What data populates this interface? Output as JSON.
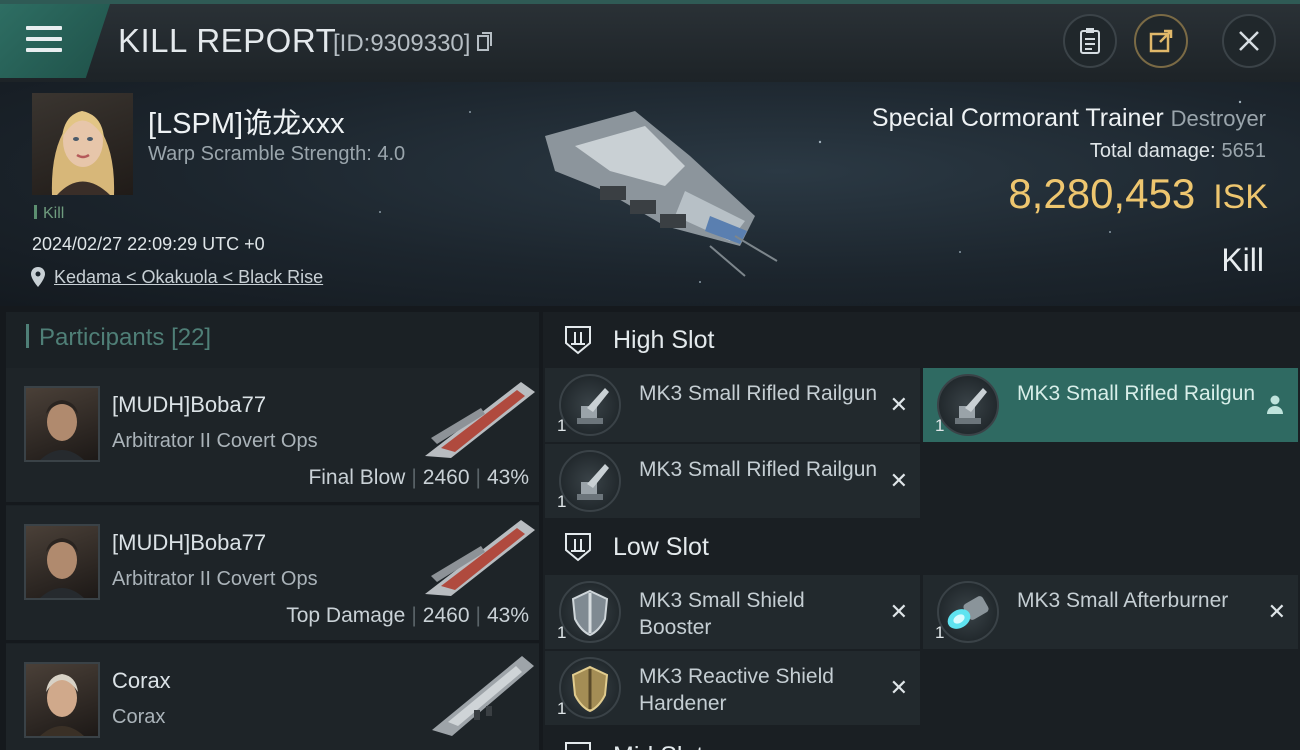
{
  "header": {
    "title": "KILL REPORT",
    "report_id": "[ID:9309330]"
  },
  "victim": {
    "name": "[LSPM]诡龙xxx",
    "warp_scramble": "Warp Scramble Strength: 4.0",
    "tag": "Kill",
    "datetime": "2024/02/27 22:09:29 UTC +0",
    "location": "Kedama < Okakuola < Black Rise",
    "ship_name": "Special Cormorant Trainer",
    "ship_class": "Destroyer",
    "damage_label": "Total damage:",
    "damage_value": "5651",
    "isk_value": "8,280,453",
    "isk_unit": "ISK",
    "result": "Kill"
  },
  "participants": {
    "label": "Participants",
    "count": "[22]",
    "rows": [
      {
        "name": "[MUDH]Boba77",
        "ship": "Arbitrator II Covert Ops",
        "role": "Final Blow",
        "damage": "2460",
        "percent": "43%"
      },
      {
        "name": "[MUDH]Boba77",
        "ship": "Arbitrator II Covert Ops",
        "role": "Top Damage",
        "damage": "2460",
        "percent": "43%"
      },
      {
        "name": "Corax",
        "ship": "Corax",
        "role": "",
        "damage": "",
        "percent": ""
      }
    ]
  },
  "slots": {
    "high": {
      "label": "High Slot",
      "modules": [
        {
          "name": "MK3 Small Rifled Railgun",
          "qty": "1",
          "icon": "railgun-icon"
        },
        {
          "name": "MK3 Small Rifled Railgun",
          "qty": "1",
          "icon": "railgun-icon"
        },
        {
          "name": "MK3 Small Rifled Railgun",
          "qty": "1",
          "icon": "railgun-icon"
        }
      ]
    },
    "low": {
      "label": "Low Slot",
      "modules": [
        {
          "name": "MK3 Small Shield Booster",
          "qty": "1",
          "icon": "shield-booster-icon"
        },
        {
          "name": "MK3 Small Afterburner",
          "qty": "1",
          "icon": "afterburner-icon"
        },
        {
          "name": "MK3 Reactive Shield Hardener",
          "qty": "1",
          "icon": "shield-hardener-icon"
        }
      ]
    },
    "mid": {
      "label": "Mid Slot"
    }
  },
  "colors": {
    "accent": "#2f6a62",
    "isk": "#eec66f",
    "teal": "#4f7f77"
  }
}
